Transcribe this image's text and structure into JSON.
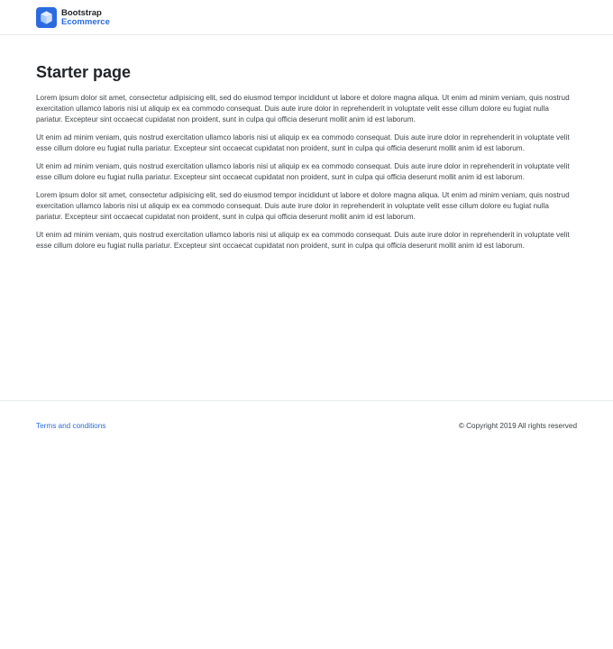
{
  "brand": {
    "name": "Bootstrap",
    "sub": "Ecommerce",
    "logo_color": "#2b6bdf"
  },
  "main": {
    "title": "Starter page",
    "paragraphs": [
      "Lorem ipsum dolor sit amet, consectetur adipisicing elit, sed do eiusmod tempor incididunt ut labore et dolore magna aliqua. Ut enim ad minim veniam, quis nostrud exercitation ullamco laboris nisi ut aliquip ex ea commodo consequat. Duis aute irure dolor in reprehenderit in voluptate velit esse cillum dolore eu fugiat nulla pariatur. Excepteur sint occaecat cupidatat non proident, sunt in culpa qui officia deserunt mollit anim id est laborum.",
      "Ut enim ad minim veniam, quis nostrud exercitation ullamco laboris nisi ut aliquip ex ea commodo consequat. Duis aute irure dolor in reprehenderit in voluptate velit esse cillum dolore eu fugiat nulla pariatur. Excepteur sint occaecat cupidatat non proident, sunt in culpa qui officia deserunt mollit anim id est laborum.",
      "Ut enim ad minim veniam, quis nostrud exercitation ullamco laboris nisi ut aliquip ex ea commodo consequat. Duis aute irure dolor in reprehenderit in voluptate velit esse cillum dolore eu fugiat nulla pariatur. Excepteur sint occaecat cupidatat non proident, sunt in culpa qui officia deserunt mollit anim id est laborum.",
      "Lorem ipsum dolor sit amet, consectetur adipisicing elit, sed do eiusmod tempor incididunt ut labore et dolore magna aliqua. Ut enim ad minim veniam, quis nostrud exercitation ullamco laboris nisi ut aliquip ex ea commodo consequat. Duis aute irure dolor in reprehenderit in voluptate velit esse cillum dolore eu fugiat nulla pariatur. Excepteur sint occaecat cupidatat non proident, sunt in culpa qui officia deserunt mollit anim id est laborum.",
      "Ut enim ad minim veniam, quis nostrud exercitation ullamco laboris nisi ut aliquip ex ea commodo consequat. Duis aute irure dolor in reprehenderit in voluptate velit esse cillum dolore eu fugiat nulla pariatur. Excepteur sint occaecat cupidatat non proident, sunt in culpa qui officia deserunt mollit anim id est laborum."
    ]
  },
  "footer": {
    "terms_label": "Terms and conditions",
    "copyright": "© Copyright 2019 All rights reserved",
    "link_color": "#2b6bdf"
  }
}
